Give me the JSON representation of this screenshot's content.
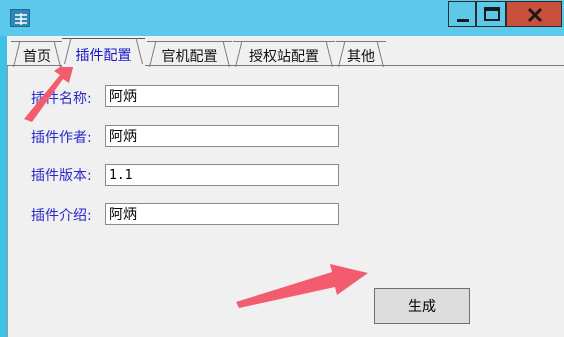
{
  "window": {
    "icon": "app-logo-icon",
    "controls": [
      "minimize-icon",
      "maximize-icon",
      "close-icon"
    ]
  },
  "tabs": [
    {
      "label": "首页",
      "active": false
    },
    {
      "label": "插件配置",
      "active": true
    },
    {
      "label": "官机配置",
      "active": false
    },
    {
      "label": "授权站配置",
      "active": false
    },
    {
      "label": "其他",
      "active": false
    }
  ],
  "form": {
    "name_label": "插件名称:",
    "name_value": "阿炳",
    "author_label": "插件作者:",
    "author_value": "阿炳",
    "version_label": "插件版本:",
    "version_value": "1.1",
    "intro_label": "插件介绍:",
    "intro_value": "阿炳"
  },
  "buttons": {
    "generate_label": "生成"
  },
  "colors": {
    "titlebar": "#5cc8ea",
    "close_button": "#c9503c",
    "label_text": "#2a2acc",
    "annotation_arrow": "#f25c6e"
  }
}
